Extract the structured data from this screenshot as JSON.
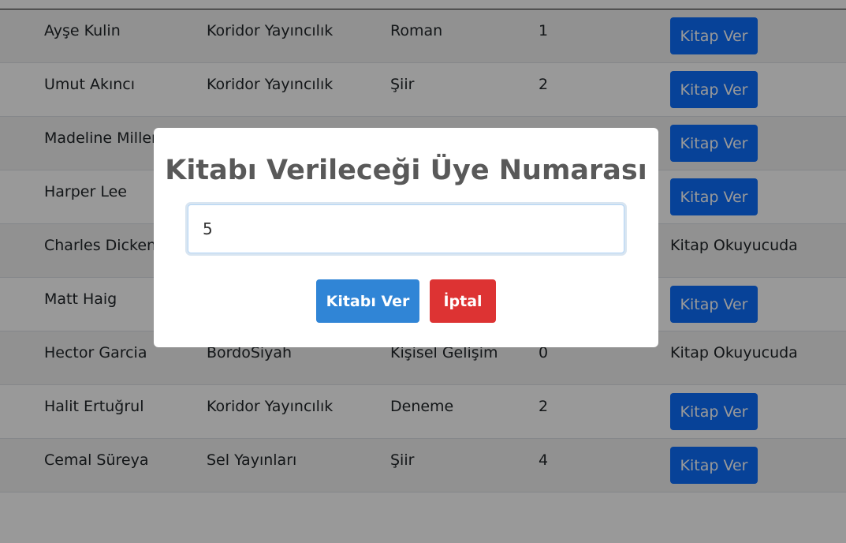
{
  "table": {
    "action_label": "Kitap Ver",
    "rows": [
      {
        "author": "Ayşe Kulin",
        "publisher": "Koridor Yayıncılık",
        "genre": "Roman",
        "count": "1",
        "status": ""
      },
      {
        "author": "Umut Akıncı",
        "publisher": "Koridor Yayıncılık",
        "genre": "Şiir",
        "count": "2",
        "status": ""
      },
      {
        "author": "Madeline Miller",
        "publisher": "",
        "genre": "",
        "count": "",
        "status": ""
      },
      {
        "author": "Harper Lee",
        "publisher": "",
        "genre": "",
        "count": "",
        "status": ""
      },
      {
        "author": "Charles Dickens",
        "publisher": "",
        "genre": "",
        "count": "",
        "status": "Kitap Okuyucuda"
      },
      {
        "author": "Matt Haig",
        "publisher": "",
        "genre": "",
        "count": "",
        "status": ""
      },
      {
        "author": "Hector Garcia",
        "publisher": "BordoSiyah",
        "genre": "Kişisel Gelişim",
        "count": "0",
        "status": "Kitap Okuyucuda"
      },
      {
        "author": "Halit Ertuğrul",
        "publisher": "Koridor Yayıncılık",
        "genre": "Deneme",
        "count": "2",
        "status": ""
      },
      {
        "author": "Cemal Süreya",
        "publisher": "Sel Yayınları",
        "genre": "Şiir",
        "count": "4",
        "status": ""
      }
    ]
  },
  "modal": {
    "title": "Kitabı Verileceği Üye Numarası",
    "input_value": "5",
    "confirm_label": "Kitabı Ver",
    "cancel_label": "İptal"
  },
  "colors": {
    "primary": "#0d6efd",
    "confirm": "#3085d6",
    "cancel": "#dd3333"
  }
}
